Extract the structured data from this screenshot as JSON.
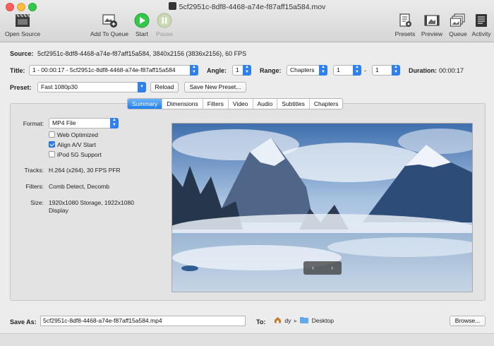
{
  "window": {
    "title": "5cf2951c-8df8-4468-a74e-f87aff15a584.mov"
  },
  "toolbar": {
    "open_source": "Open Source",
    "add_to_queue": "Add To Queue",
    "start": "Start",
    "pause": "Pause",
    "presets": "Presets",
    "preview": "Preview",
    "queue": "Queue",
    "activity": "Activity"
  },
  "source": {
    "label": "Source:",
    "value": "5cf2951c-8df8-4468-a74e-f87aff15a584, 3840x2156 (3836x2156), 60 FPS"
  },
  "title_row": {
    "label": "Title:",
    "title_value": "1 - 00:00:17 - 5cf2951c-8df8-4468-a74e-f87aff15a584",
    "angle_label": "Angle:",
    "angle_value": "1",
    "range_label": "Range:",
    "range_value": "Chapters",
    "range_from": "1",
    "dash": "-",
    "range_to": "1",
    "duration_label": "Duration:",
    "duration_value": "00:00:17"
  },
  "preset_row": {
    "label": "Preset:",
    "value": "Fast 1080p30",
    "reload": "Reload",
    "save_new": "Save New Preset..."
  },
  "tabs": [
    "Summary",
    "Dimensions",
    "Filters",
    "Video",
    "Audio",
    "Subtitles",
    "Chapters"
  ],
  "summary": {
    "format_label": "Format:",
    "format_value": "MP4 File",
    "web_optimized": "Web Optimized",
    "align_av": "Align A/V Start",
    "ipod": "iPod 5G Support",
    "tracks_label": "Tracks:",
    "tracks_value": "H.264 (x264), 30 FPS PFR",
    "filters_label": "Filters:",
    "filters_value": "Comb Detect, Decomb",
    "size_label": "Size:",
    "size_value_line1": "1920x1080 Storage, 1922x1080",
    "size_value_line2": "Display"
  },
  "preview_nav": {
    "prev": "‹",
    "next": "›"
  },
  "save_as": {
    "label": "Save As:",
    "value": "5cf2951c-8df8-4468-a74e-f87aff15a584.mp4",
    "to_label": "To:",
    "user": "dy",
    "folder": "Desktop",
    "browse": "Browse..."
  },
  "colors": {
    "accent": "#2f80ed",
    "start_green": "#34c84a"
  }
}
